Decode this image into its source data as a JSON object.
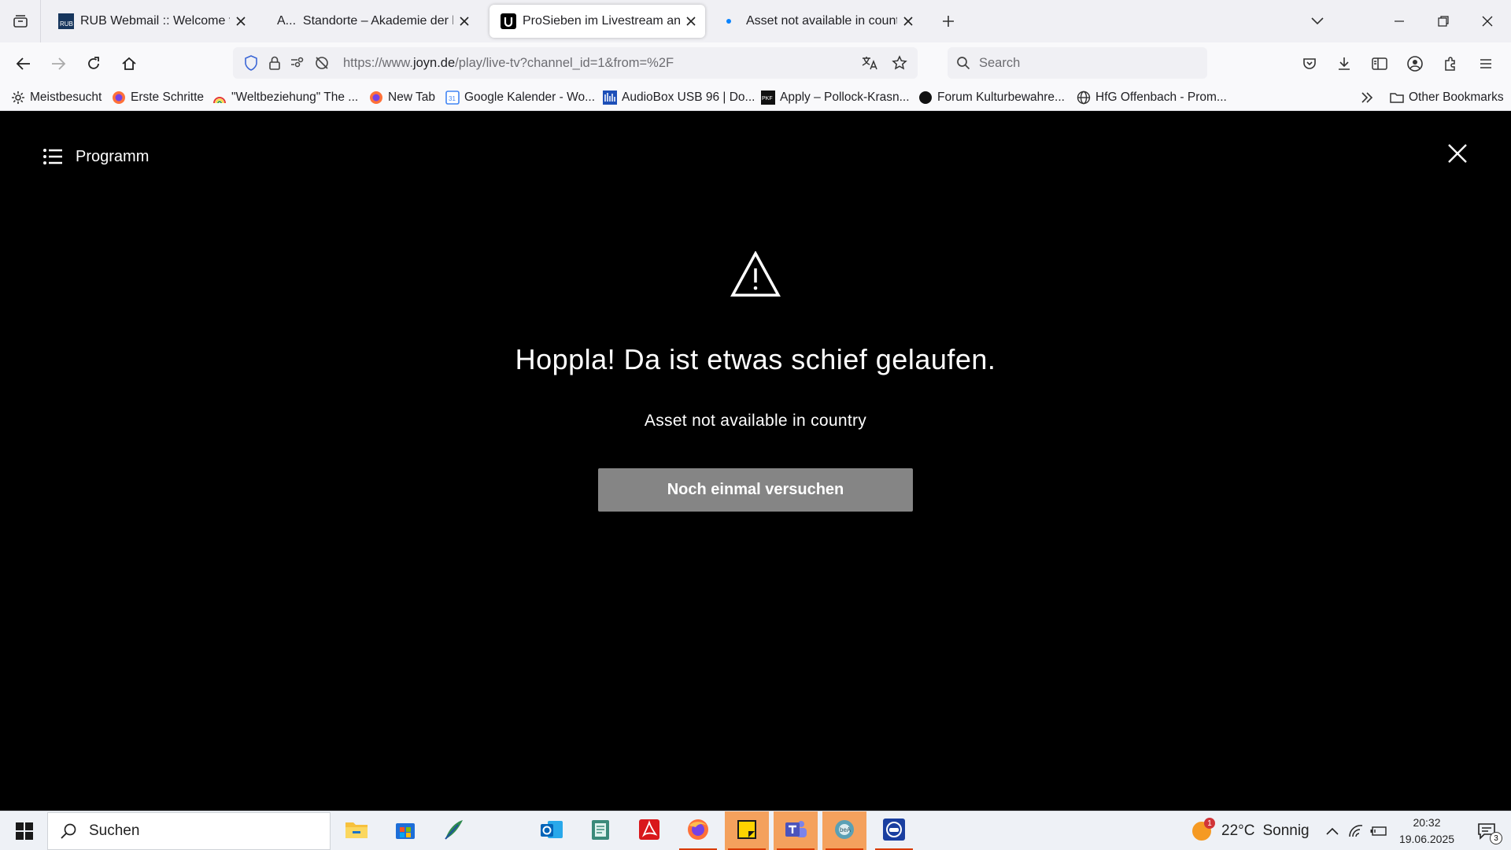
{
  "browser": {
    "tabs": [
      {
        "title": "RUB Webmail :: Welcome to RUB Webmail",
        "favicon": "rub-favicon",
        "active": false
      },
      {
        "title": "Standorte – Akademie der bildenden Künste",
        "prefix": "A...",
        "favicon": "akademie-favicon",
        "active": false
      },
      {
        "title": "ProSieben im Livestream anschauen | Joyn",
        "favicon": "joyn-favicon",
        "active": true
      },
      {
        "title": "Asset not available in country | Joyn",
        "favicon": "loading-dot",
        "active": false
      }
    ],
    "url": {
      "prefix": "https://www.",
      "host": "joyn.de",
      "path": "/play/live-tv?channel_id=1&from=%2F"
    },
    "search_placeholder": "Search",
    "bookmarks": [
      {
        "label": "Meistbesucht",
        "icon": "gear-icon"
      },
      {
        "label": "Erste Schritte",
        "icon": "firefox-icon"
      },
      {
        "label": "\"Weltbeziehung\" The ...",
        "icon": "rainbow-icon"
      },
      {
        "label": "New Tab",
        "icon": "firefox-icon"
      },
      {
        "label": "Google Kalender - Wo...",
        "icon": "calendar-icon"
      },
      {
        "label": "AudioBox USB 96 | Do...",
        "icon": "audiobox-icon"
      },
      {
        "label": "Apply – Pollock-Krasn...",
        "icon": "pkf-icon"
      },
      {
        "label": "Forum Kulturbewahre...",
        "icon": "circle-icon"
      },
      {
        "label": "HfG Offenbach - Prom...",
        "icon": "globe-icon"
      }
    ],
    "other_bookmarks": "Other Bookmarks"
  },
  "player": {
    "program_label": "Programm",
    "error_title": "Hoppla! Da ist etwas schief gelaufen.",
    "error_message": "Asset not available in country",
    "retry_label": "Noch einmal versuchen"
  },
  "taskbar": {
    "search_label": "Suchen",
    "apps": [
      "file-explorer",
      "microsoft-store",
      "feather-app",
      "outlook",
      "notepad-app",
      "acrobat",
      "firefox",
      "sticky-notes",
      "teams",
      "bea-app",
      "remote-app"
    ],
    "weather": {
      "temp": "22°C",
      "condition": "Sonnig",
      "badge": "1"
    },
    "time": "20:32",
    "date": "19.06.2025",
    "notifications": "3"
  },
  "colors": {
    "page_bg": "#000000",
    "retry_bg": "#858585",
    "taskbar_bg": "#eef1f6",
    "chrome_bg": "#f0f0f4"
  }
}
